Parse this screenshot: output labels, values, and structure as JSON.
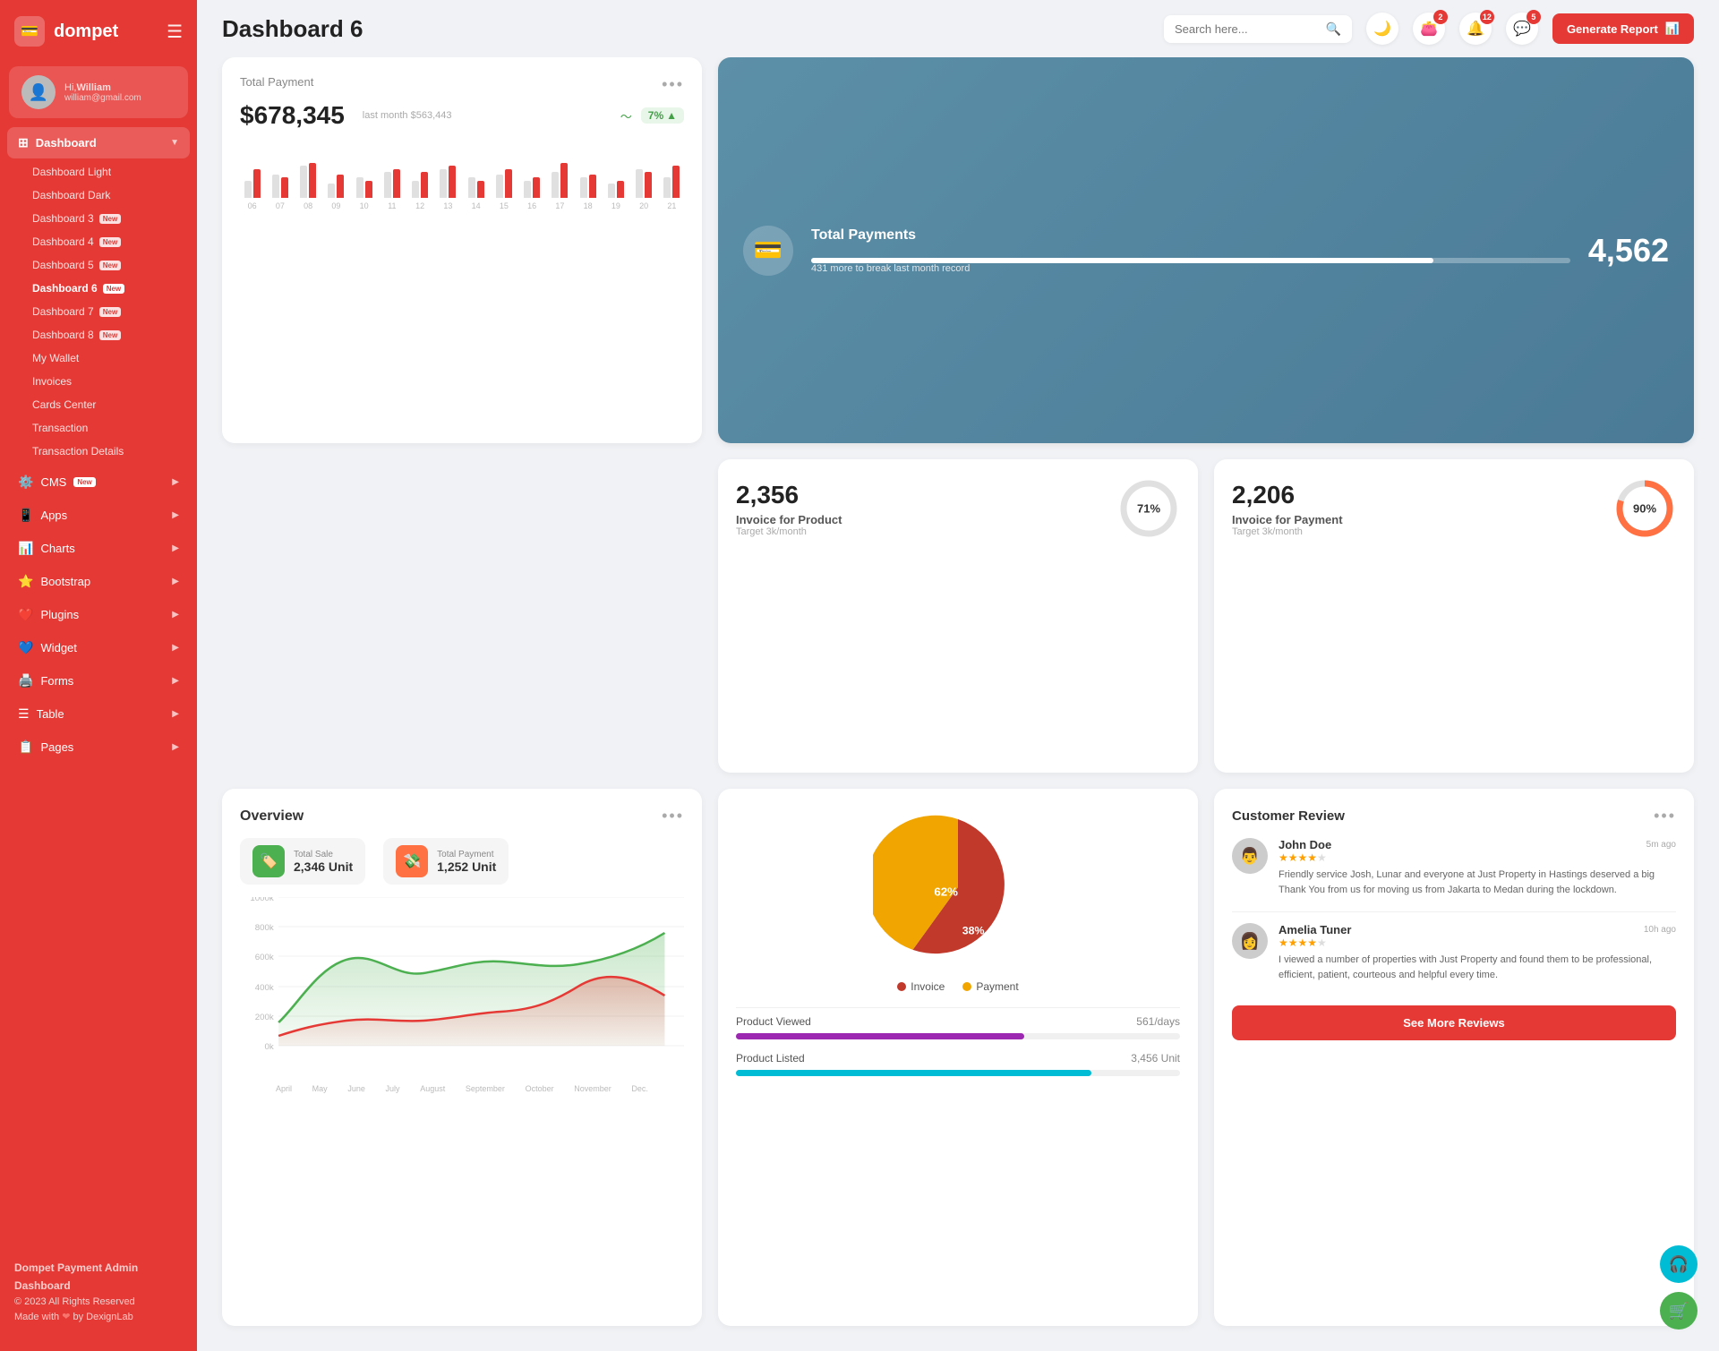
{
  "app": {
    "name": "dompet",
    "logo_icon": "💳"
  },
  "user": {
    "greeting": "Hi,",
    "name": "William",
    "email": "william@gmail.com",
    "avatar_icon": "👤"
  },
  "sidebar": {
    "dashboard_label": "Dashboard",
    "items": [
      {
        "id": "dashboard-light",
        "label": "Dashboard Light",
        "badge": ""
      },
      {
        "id": "dashboard-dark",
        "label": "Dashboard Dark",
        "badge": ""
      },
      {
        "id": "dashboard-3",
        "label": "Dashboard 3",
        "badge": "New"
      },
      {
        "id": "dashboard-4",
        "label": "Dashboard 4",
        "badge": "New"
      },
      {
        "id": "dashboard-5",
        "label": "Dashboard 5",
        "badge": "New"
      },
      {
        "id": "dashboard-6",
        "label": "Dashboard 6",
        "badge": "New",
        "active": true
      },
      {
        "id": "dashboard-7",
        "label": "Dashboard 7",
        "badge": "New"
      },
      {
        "id": "dashboard-8",
        "label": "Dashboard 8",
        "badge": "New"
      },
      {
        "id": "my-wallet",
        "label": "My Wallet",
        "badge": ""
      },
      {
        "id": "invoices",
        "label": "Invoices",
        "badge": ""
      },
      {
        "id": "cards-center",
        "label": "Cards Center",
        "badge": ""
      },
      {
        "id": "transaction",
        "label": "Transaction",
        "badge": ""
      },
      {
        "id": "transaction-details",
        "label": "Transaction Details",
        "badge": ""
      }
    ],
    "nav_items": [
      {
        "id": "cms",
        "label": "CMS",
        "badge": "New",
        "icon": "⚙️",
        "has_arrow": true
      },
      {
        "id": "apps",
        "label": "Apps",
        "badge": "",
        "icon": "📱",
        "has_arrow": true
      },
      {
        "id": "charts",
        "label": "Charts",
        "badge": "",
        "icon": "📊",
        "has_arrow": true
      },
      {
        "id": "bootstrap",
        "label": "Bootstrap",
        "badge": "",
        "icon": "⭐",
        "has_arrow": true
      },
      {
        "id": "plugins",
        "label": "Plugins",
        "badge": "",
        "icon": "❤️",
        "has_arrow": true
      },
      {
        "id": "widget",
        "label": "Widget",
        "badge": "",
        "icon": "💙",
        "has_arrow": true
      },
      {
        "id": "forms",
        "label": "Forms",
        "badge": "",
        "icon": "🖨️",
        "has_arrow": true
      },
      {
        "id": "table",
        "label": "Table",
        "badge": "",
        "icon": "☰",
        "has_arrow": true
      },
      {
        "id": "pages",
        "label": "Pages",
        "badge": "",
        "icon": "📋",
        "has_arrow": true
      }
    ],
    "footer": {
      "brand": "Dompet Payment Admin Dashboard",
      "copyright": "© 2023 All Rights Reserved",
      "made_with": "Made with",
      "by": "by DexignLab"
    }
  },
  "topbar": {
    "title": "Dashboard 6",
    "search_placeholder": "Search here...",
    "badges": {
      "wallet": "2",
      "bell": "12",
      "chat": "5"
    },
    "generate_btn": "Generate Report"
  },
  "total_payment": {
    "title": "Total Payment",
    "amount": "$678,345",
    "last_month": "last month $563,443",
    "trend": "7%",
    "bars": [
      {
        "gray": 30,
        "red": 50,
        "label": "06"
      },
      {
        "gray": 40,
        "red": 35,
        "label": "07"
      },
      {
        "gray": 55,
        "red": 60,
        "label": "08"
      },
      {
        "gray": 25,
        "red": 40,
        "label": "09"
      },
      {
        "gray": 35,
        "red": 30,
        "label": "10"
      },
      {
        "gray": 45,
        "red": 50,
        "label": "11"
      },
      {
        "gray": 30,
        "red": 45,
        "label": "12"
      },
      {
        "gray": 50,
        "red": 55,
        "label": "13"
      },
      {
        "gray": 35,
        "red": 30,
        "label": "14"
      },
      {
        "gray": 40,
        "red": 50,
        "label": "15"
      },
      {
        "gray": 30,
        "red": 35,
        "label": "16"
      },
      {
        "gray": 45,
        "red": 60,
        "label": "17"
      },
      {
        "gray": 35,
        "red": 40,
        "label": "18"
      },
      {
        "gray": 25,
        "red": 30,
        "label": "19"
      },
      {
        "gray": 50,
        "red": 45,
        "label": "20"
      },
      {
        "gray": 35,
        "red": 55,
        "label": "21"
      }
    ]
  },
  "total_payments_blue": {
    "title": "Total Payments",
    "subtitle": "431 more to break last month record",
    "value": "4,562",
    "progress": 82
  },
  "invoice_product": {
    "value": "2,356",
    "label": "Invoice for Product",
    "target": "Target 3k/month",
    "percent": 71,
    "color": "#4caf50"
  },
  "invoice_payment": {
    "value": "2,206",
    "label": "Invoice for Payment",
    "target": "Target 3k/month",
    "percent": 90,
    "color": "#ff7043"
  },
  "overview": {
    "title": "Overview",
    "total_sale_label": "Total Sale",
    "total_sale_value": "2,346 Unit",
    "total_payment_label": "Total Payment",
    "total_payment_value": "1,252 Unit",
    "x_labels": [
      "April",
      "May",
      "June",
      "July",
      "August",
      "September",
      "October",
      "November",
      "Dec."
    ],
    "y_labels": [
      "1000k",
      "800k",
      "600k",
      "400k",
      "200k",
      "0k"
    ]
  },
  "pie_chart": {
    "invoice_pct": 62,
    "payment_pct": 38,
    "invoice_label": "Invoice",
    "payment_label": "Payment",
    "invoice_color": "#c0392b",
    "payment_color": "#f0a500"
  },
  "product_stats": {
    "viewed_label": "Product Viewed",
    "viewed_value": "561/days",
    "viewed_progress": 65,
    "listed_label": "Product Listed",
    "listed_value": "3,456 Unit",
    "listed_progress": 80
  },
  "customer_review": {
    "title": "Customer Review",
    "reviews": [
      {
        "name": "John Doe",
        "time": "5m ago",
        "stars": 4,
        "text": "Friendly service Josh, Lunar and everyone at Just Property in Hastings deserved a big Thank You from us for moving us from Jakarta to Medan during the lockdown.",
        "avatar": "👨"
      },
      {
        "name": "Amelia Tuner",
        "time": "10h ago",
        "stars": 4,
        "text": "I viewed a number of properties with Just Property and found them to be professional, efficient, patient, courteous and helpful every time.",
        "avatar": "👩"
      }
    ],
    "see_more_btn": "See More Reviews"
  },
  "floating": {
    "support_icon": "🎧",
    "cart_icon": "🛒"
  }
}
